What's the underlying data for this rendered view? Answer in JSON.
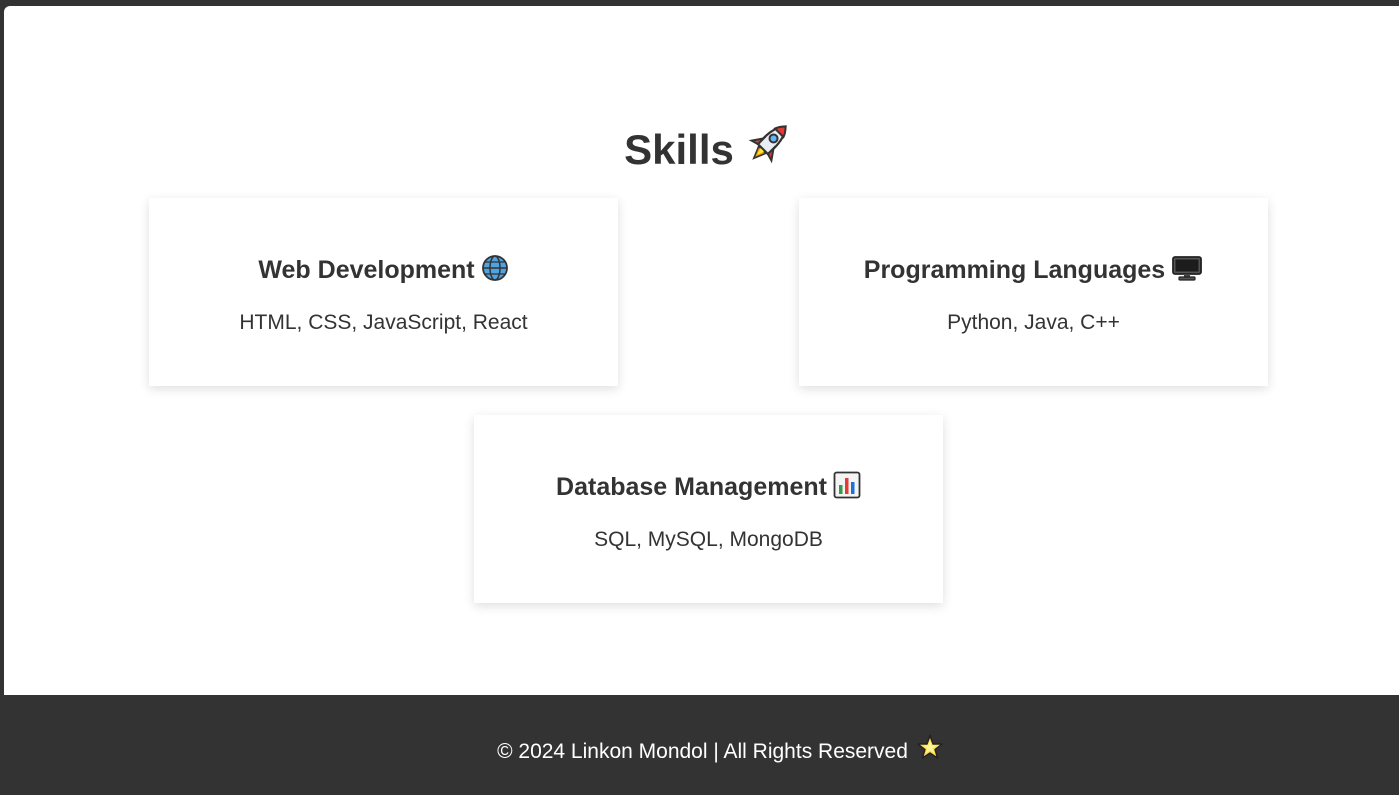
{
  "skills_section": {
    "title": "Skills",
    "title_icon": "rocket-icon",
    "cards": [
      {
        "title": "Web Development",
        "icon": "globe-icon",
        "items": "HTML, CSS, JavaScript, React"
      },
      {
        "title": "Programming Languages",
        "icon": "desktop-computer-icon",
        "items": "Python, Java, C++"
      },
      {
        "title": "Database Management",
        "icon": "bar-chart-icon",
        "items": "SQL, MySQL, MongoDB"
      }
    ]
  },
  "footer": {
    "text": "© 2024 Linkon Mondol | All Rights Reserved",
    "icon": "glowing-star-icon"
  },
  "colors": {
    "page_background": "#ffffff",
    "frame_background": "#333333",
    "text_dark": "#333333",
    "footer_text": "#ffffff"
  }
}
